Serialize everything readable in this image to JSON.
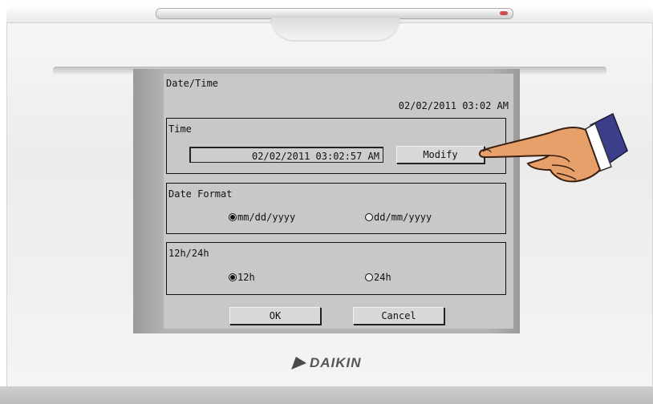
{
  "screen": {
    "title": "Date/Time",
    "current_datetime": "02/02/2011 03:02 AM"
  },
  "time_group": {
    "label": "Time",
    "value": "02/02/2011 03:02:57 AM",
    "modify_label": "Modify"
  },
  "date_format_group": {
    "label": "Date Format",
    "options": [
      {
        "label": "mm/dd/yyyy",
        "selected": true
      },
      {
        "label": "dd/mm/yyyy",
        "selected": false
      }
    ]
  },
  "hour_format_group": {
    "label": "12h/24h",
    "options": [
      {
        "label": "12h",
        "selected": true
      },
      {
        "label": "24h",
        "selected": false
      }
    ]
  },
  "footer": {
    "ok_label": "OK",
    "cancel_label": "Cancel"
  },
  "device": {
    "brand": "DAIKIN"
  },
  "colors": {
    "screen_bg": "#c8c8c8",
    "bezel": "#b3b3b3",
    "housing": "#f2f2f2"
  }
}
